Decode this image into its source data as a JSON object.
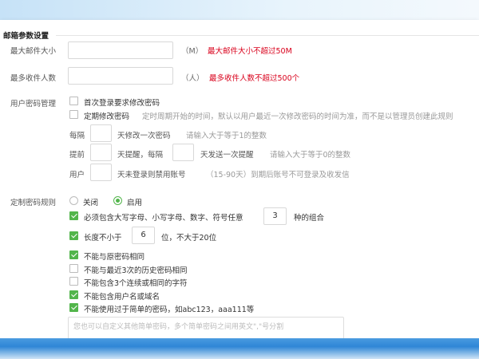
{
  "section": {
    "title": "邮箱参数设置"
  },
  "max_mail_size": {
    "label": "最大邮件大小",
    "value": "",
    "unit": "（M）",
    "hint": "最大邮件大小不超过50M"
  },
  "max_recipients": {
    "label": "最多收件人数",
    "value": "",
    "unit": "（人）",
    "hint": "最多收件人数不超过500个"
  },
  "password_mgmt": {
    "label": "用户密码管理",
    "first_login": {
      "label": "首次登录要求修改密码",
      "checked": false
    },
    "periodic": {
      "label": "定期修改密码",
      "checked": false,
      "desc": "定时周期开始的时间，默认以用户最近一次修改密码的时间为准，而不是以管理员创建此规则"
    },
    "every": {
      "prefix": "每隔",
      "value": "",
      "suffix": "天修改一次密码",
      "hint": "请输入大于等于1的整数"
    },
    "remind": {
      "prefix": "提前",
      "value1": "",
      "middle": "天提醒，每隔",
      "value2": "",
      "suffix": "天发送一次提醒",
      "hint": "请输入大于等于0的整数"
    },
    "disable": {
      "prefix": "用户",
      "value": "",
      "suffix": "天未登录则禁用账号",
      "hint": "（15-90天）到期后账号不可登录及收发信"
    }
  },
  "custom_rules": {
    "label": "定制密码规则",
    "radio_off": "关闭",
    "radio_on": "启用",
    "selected": "启用",
    "combo": {
      "prefix": "必须包含大写字母、小写字母、数字、符号任意",
      "value": "3",
      "suffix": "种的组合",
      "checked": true
    },
    "length": {
      "prefix": "长度不小于",
      "value": "6",
      "suffix": "位，不大于20位",
      "checked": true
    },
    "rules": [
      {
        "label": "不能与原密码相同",
        "checked": true
      },
      {
        "label": "不能与最近3次的历史密码相同",
        "checked": false
      },
      {
        "label": "不能包含3个连续或相同的字符",
        "checked": false
      },
      {
        "label": "不能包含用户名或域名",
        "checked": true
      },
      {
        "label": "不能使用过于简单的密码，如abc123，aaa111等",
        "checked": true
      }
    ],
    "custom_placeholder": "您也可以自定义其他简单密码，多个简单密码之间用英文\",\"号分割"
  },
  "colors": {
    "accent": "#52b54b",
    "warning": "#d9001b",
    "bottom_bar": "#2f86d6"
  }
}
